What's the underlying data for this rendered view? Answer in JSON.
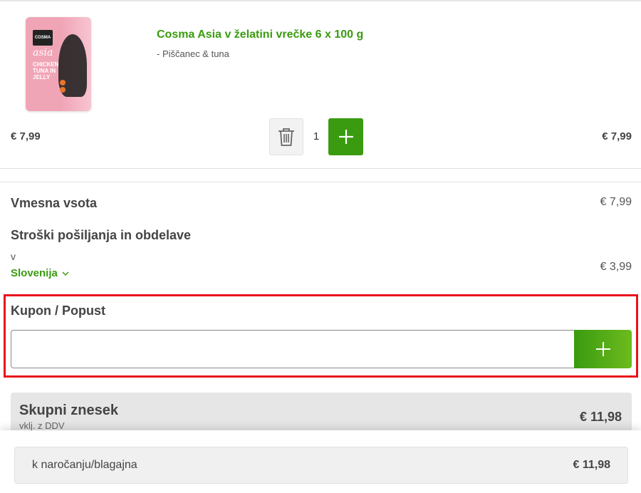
{
  "product": {
    "title": "Cosma Asia v želatini vrečke 6 x 100 g",
    "variant": "- Piščanec & tuna",
    "unit_price": "€ 7,99",
    "line_total": "€ 7,99",
    "quantity": "1",
    "image": {
      "brand": "COSMA",
      "line": "asia",
      "flavor": "CHICKEN TUNA IN JELLY",
      "background_color": "#f0a5b6"
    },
    "icons": {
      "delete": "trash-icon",
      "increase": "plus-icon"
    }
  },
  "summary": {
    "subtotal_label": "Vmesna vsota",
    "subtotal_value": "€ 7,99",
    "shipping_label": "Stroški pošiljanja in obdelave",
    "shipping_in": "v",
    "shipping_country": "Slovenija",
    "shipping_value": "€ 3,99"
  },
  "coupon": {
    "label": "Kupon / Popust",
    "input_value": "",
    "highlight_color": "#e8131b"
  },
  "total": {
    "label": "Skupni znesek",
    "sublabel": "vklj. z DDV",
    "value": "€ 11,98"
  },
  "checkout": {
    "label": "k naročanju/blagajna",
    "value": "€ 11,98"
  },
  "colors": {
    "accent_green": "#3a9b10",
    "highlight_red": "#e8131b"
  }
}
